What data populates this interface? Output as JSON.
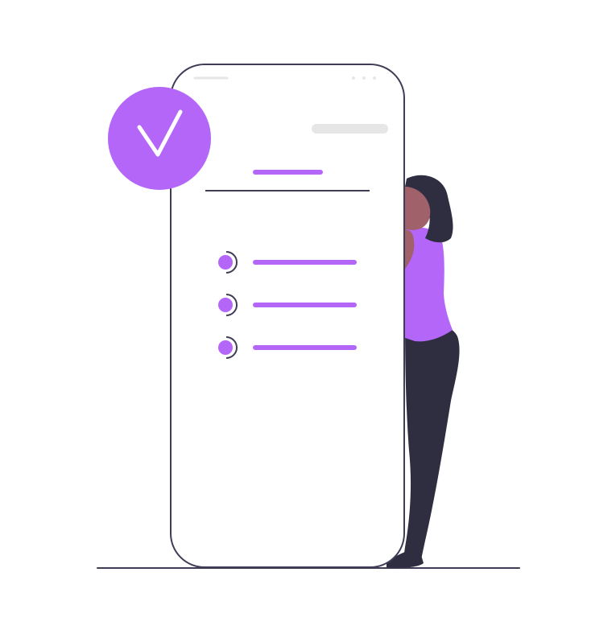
{
  "illustration": {
    "colors": {
      "accent": "#b366f8",
      "outline": "#3f3d56",
      "placeholder": "#e6e6e6",
      "skin": "#a0616a",
      "hair": "#2f2e41",
      "pants": "#2f2e41",
      "background": "#ffffff"
    },
    "checklist": {
      "item_count": 3
    },
    "icons": {
      "badge": "check-mark-icon"
    }
  }
}
